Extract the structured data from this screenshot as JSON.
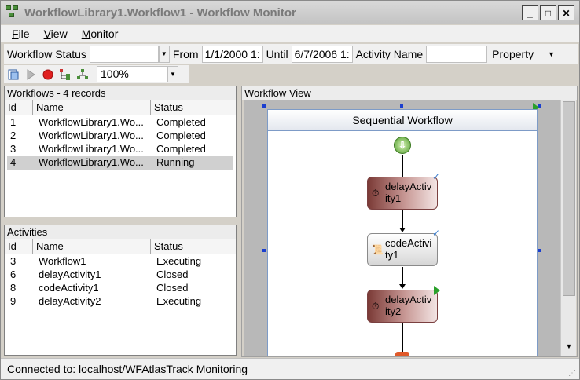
{
  "window": {
    "title": "WorkflowLibrary1.Workflow1 - Workflow Monitor",
    "minimize": "_",
    "maximize": "□",
    "close": "✕"
  },
  "menu": [
    {
      "label": "File",
      "hotkey": "F"
    },
    {
      "label": "View",
      "hotkey": "V"
    },
    {
      "label": "Monitor",
      "hotkey": "M"
    }
  ],
  "filter": {
    "status_label": "Workflow Status",
    "status_value": "",
    "from_label": "From",
    "from_value": "1/1/2000 1:",
    "until_label": "Until",
    "until_value": "6/7/2006 1:",
    "activity_label": "Activity Name",
    "activity_value": "",
    "property_label": "Property"
  },
  "toolbar": {
    "zoom": "100%"
  },
  "workflows": {
    "header": "Workflows - 4 records",
    "columns": [
      "Id",
      "Name",
      "Status"
    ],
    "rows": [
      {
        "id": "1",
        "name": "WorkflowLibrary1.Wo...",
        "status": "Completed"
      },
      {
        "id": "2",
        "name": "WorkflowLibrary1.Wo...",
        "status": "Completed"
      },
      {
        "id": "3",
        "name": "WorkflowLibrary1.Wo...",
        "status": "Completed"
      },
      {
        "id": "4",
        "name": "WorkflowLibrary1.Wo...",
        "status": "Running"
      }
    ],
    "selected_index": 3
  },
  "activities": {
    "header": "Activities",
    "columns": [
      "Id",
      "Name",
      "Status"
    ],
    "rows": [
      {
        "id": "3",
        "name": "Workflow1",
        "status": "Executing"
      },
      {
        "id": "6",
        "name": "delayActivity1",
        "status": "Closed"
      },
      {
        "id": "8",
        "name": "codeActivity1",
        "status": "Closed"
      },
      {
        "id": "9",
        "name": "delayActivity2",
        "status": "Executing"
      }
    ]
  },
  "workflow_view": {
    "header": "Workflow View",
    "title": "Sequential Workflow",
    "activities": [
      {
        "line1": "delayActiv",
        "line2": "ity1",
        "kind": "delay",
        "state": "completed"
      },
      {
        "line1": "codeActivi",
        "line2": "ty1",
        "kind": "code",
        "state": "completed"
      },
      {
        "line1": "delayActiv",
        "line2": "ity2",
        "kind": "delay",
        "state": "executing"
      }
    ]
  },
  "status": {
    "text": "Connected to: localhost/WFAtlasTrack Monitoring"
  },
  "colors": {
    "accent_check": "#3c7fd0",
    "running_flag": "#2aa02a",
    "delay_fill": "#7b3a36"
  }
}
